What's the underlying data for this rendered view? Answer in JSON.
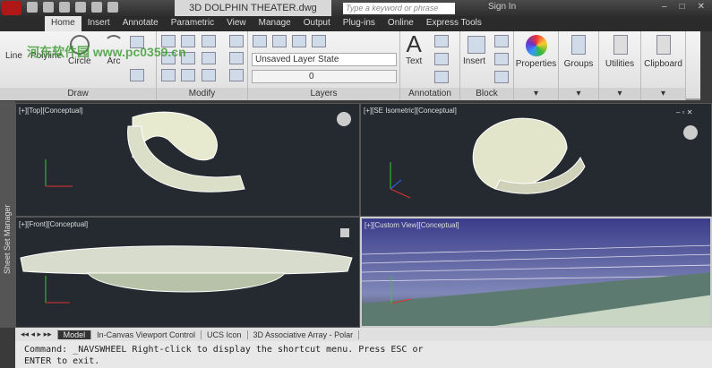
{
  "title": {
    "document": "3D DOLPHIN THEATER.dwg",
    "search_placeholder": "Type a keyword or phrase",
    "sign_in": "Sign In",
    "watermark": "河东软件园 www.pc0359.cn"
  },
  "tabs": [
    "Home",
    "Insert",
    "Annotate",
    "Parametric",
    "View",
    "Manage",
    "Output",
    "Plug-ins",
    "Online",
    "Express Tools"
  ],
  "ribbon": {
    "draw": {
      "label": "Draw",
      "tools": [
        "Line",
        "Polyline",
        "Circle",
        "Arc"
      ]
    },
    "modify": {
      "label": "Modify"
    },
    "layers": {
      "label": "Layers",
      "layer_state": "Unsaved Layer State",
      "current_layer": "0"
    },
    "annotation": {
      "label": "Annotation",
      "text": "Text"
    },
    "block": {
      "label": "Block",
      "insert": "Insert"
    },
    "properties": "Properties",
    "groups": "Groups",
    "utilities": "Utilities",
    "clipboard": "Clipboard"
  },
  "sidebar": {
    "sheet_set": "Sheet Set Manager"
  },
  "viewports": [
    {
      "label": "[+][Top][Conceptual]"
    },
    {
      "label": "[+][SE Isometric][Conceptual]"
    },
    {
      "label": "[+][Front][Conceptual]"
    },
    {
      "label": "[+][Custom View][Conceptual]"
    }
  ],
  "layout_tabs": [
    "Model",
    "In-Canvas Viewport Control",
    "UCS Icon",
    "3D Associative Array - Polar"
  ],
  "command": {
    "line1": "Command: _NAVSWHEEL Right-click to display the shortcut menu. Press ESC or",
    "line2": "ENTER to exit."
  }
}
